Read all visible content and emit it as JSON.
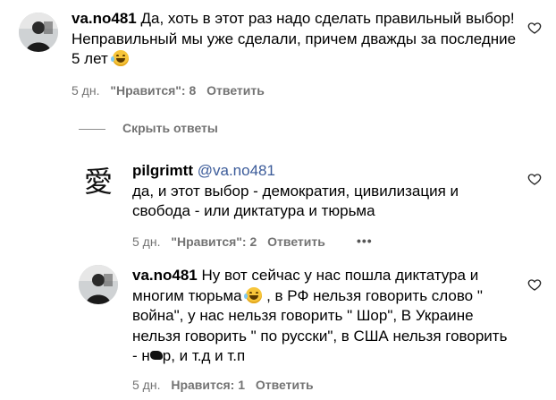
{
  "comments": [
    {
      "username": "va.no481",
      "text": "Да, хоть в этот раз надо сделать правильный выбор! Неправильный мы уже сделали, причем дважды за последние 5 лет",
      "age": "5 дн.",
      "likes": "\"Нравится\": 8",
      "reply": "Ответить"
    },
    {
      "username": "pilgrimtt",
      "mention": "@va.no481",
      "text": "да, и этот выбор - демократия, цивилизация и свобода - или диктатура и тюрьма",
      "age": "5 дн.",
      "likes": "\"Нравится\": 2",
      "reply": "Ответить",
      "more": "•••"
    },
    {
      "username": "va.no481",
      "text_part1": "Ну вот сейчас у нас пошла диктатура и многим тюрьма",
      "text_part2": ", в РФ нельзя говорить слово \" война\", у нас нельзя говорить \" Шор\", В Украине нельзя говорить \" по русски\", в США нельзя говорить - н",
      "text_part3": "р, и т.д и т.п",
      "age": "5 дн.",
      "likes": "Нравится: 1",
      "reply": "Ответить"
    }
  ],
  "hide_replies": "Скрыть ответы",
  "icons": {
    "heart": "heart-outline-icon",
    "emoji": "grinning-sweat-emoji-icon"
  },
  "colors": {
    "text": "#000000",
    "meta": "#737373",
    "mention": "#3b5b99"
  }
}
